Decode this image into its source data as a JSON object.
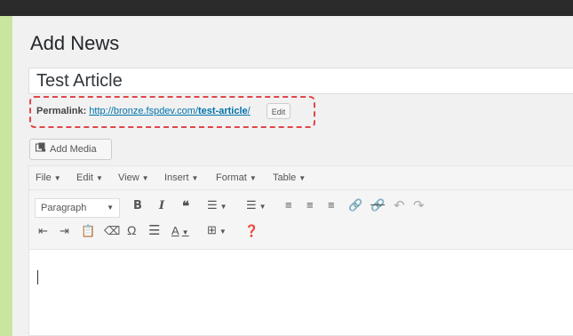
{
  "page": {
    "title": "Add News"
  },
  "post": {
    "title_value": "Test Article"
  },
  "permalink": {
    "label": "Permalink:",
    "url_prefix": "http://bronze.fspdev.com/",
    "slug": "test-article",
    "url_suffix": "/",
    "edit_label": "Edit"
  },
  "media": {
    "add_label": "Add Media",
    "icon": "media-icon"
  },
  "editor": {
    "menu": [
      {
        "label": "File"
      },
      {
        "label": "Edit"
      },
      {
        "label": "View"
      },
      {
        "label": "Insert"
      },
      {
        "label": "Format"
      },
      {
        "label": "Table"
      }
    ],
    "format_select": "Paragraph",
    "row1_icons": [
      "bold-icon",
      "italic-icon",
      "blockquote-icon",
      "bullet-list-icon",
      "numbered-list-icon",
      "align-left-icon",
      "align-center-icon",
      "align-right-icon",
      "link-icon",
      "unlink-icon",
      "undo-icon",
      "redo-icon"
    ],
    "row2_icons": [
      "outdent-icon",
      "indent-icon",
      "paste-text-icon",
      "clear-formatting-icon",
      "special-character-icon",
      "horizontal-line-icon",
      "text-color-icon",
      "table-icon",
      "help-icon"
    ]
  },
  "colors": {
    "highlight": "#e0454a",
    "link": "#0073aa",
    "frame": "#c8e6a0",
    "topbar": "#2b2b2b"
  }
}
